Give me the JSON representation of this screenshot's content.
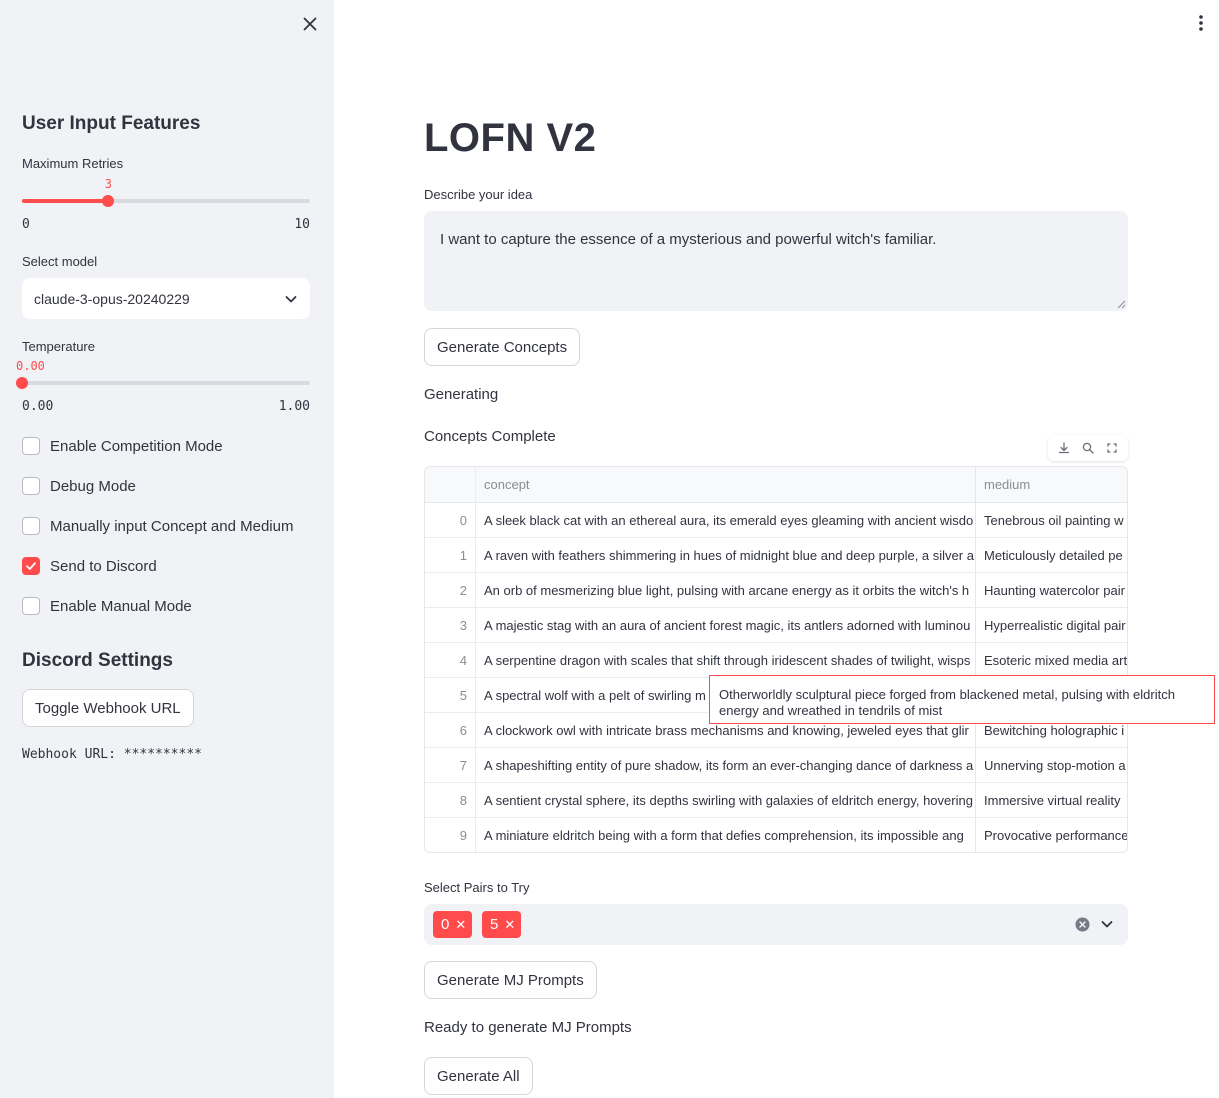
{
  "sidebar": {
    "heading": "User Input Features",
    "max_retries": {
      "label": "Maximum Retries",
      "value": "3",
      "min": "0",
      "max": "10",
      "fraction": 0.3
    },
    "model": {
      "label": "Select model",
      "value": "claude-3-opus-20240229"
    },
    "temperature": {
      "label": "Temperature",
      "value": "0.00",
      "min": "0.00",
      "max": "1.00",
      "fraction": 0.0
    },
    "checkboxes": [
      {
        "label": "Enable Competition Mode",
        "checked": false
      },
      {
        "label": "Debug Mode",
        "checked": false
      },
      {
        "label": "Manually input Concept and Medium",
        "checked": false
      },
      {
        "label": "Send to Discord",
        "checked": true
      },
      {
        "label": "Enable Manual Mode",
        "checked": false
      }
    ],
    "discord_heading": "Discord Settings",
    "toggle_webhook_label": "Toggle Webhook URL",
    "webhook_text": "Webhook URL: **********"
  },
  "main": {
    "title": "LOFN V2",
    "idea_label": "Describe your idea",
    "idea_value": "I want to capture the essence of a mysterious and powerful witch's familiar.",
    "generate_concepts_label": "Generate Concepts",
    "status_generating": "Generating",
    "status_concepts_complete": "Concepts Complete",
    "table": {
      "columns": [
        "concept",
        "medium"
      ],
      "rows": [
        {
          "idx": "0",
          "concept": "A sleek black cat with an ethereal aura, its emerald eyes gleaming with ancient wisdo",
          "medium": "Tenebrous oil painting w"
        },
        {
          "idx": "1",
          "concept": "A raven with feathers shimmering in hues of midnight blue and deep purple, a silver a",
          "medium": "Meticulously detailed pe"
        },
        {
          "idx": "2",
          "concept": "An orb of mesmerizing blue light, pulsing with arcane energy as it orbits the witch's h",
          "medium": "Haunting watercolor pair"
        },
        {
          "idx": "3",
          "concept": "A majestic stag with an aura of ancient forest magic, its antlers adorned with luminou",
          "medium": "Hyperrealistic digital pair"
        },
        {
          "idx": "4",
          "concept": "A serpentine dragon with scales that shift through iridescent shades of twilight, wisps",
          "medium": "Esoteric mixed media art"
        },
        {
          "idx": "5",
          "concept": "A spectral wolf with a pelt of swirling m",
          "medium": ""
        },
        {
          "idx": "6",
          "concept": "A clockwork owl with intricate brass mechanisms and knowing, jeweled eyes that glir",
          "medium": "Bewitching holographic i"
        },
        {
          "idx": "7",
          "concept": "A shapeshifting entity of pure shadow, its form an ever-changing dance of darkness a",
          "medium": "Unnerving stop-motion a"
        },
        {
          "idx": "8",
          "concept": "A sentient crystal sphere, its depths swirling with galaxies of eldritch energy, hovering",
          "medium": "Immersive virtual reality"
        },
        {
          "idx": "9",
          "concept": "A miniature eldritch being with a form that defies comprehension, its impossible ang",
          "medium": "Provocative performance"
        }
      ]
    },
    "tooltip_text": "Otherworldly sculptural piece forged from blackened metal, pulsing with eldritch energy and wreathed in tendrils of mist",
    "pairs_label": "Select Pairs to Try",
    "pairs_selected": [
      "0",
      "5"
    ],
    "generate_mj_label": "Generate MJ Prompts",
    "ready_text": "Ready to generate MJ Prompts",
    "generate_all_label": "Generate All"
  },
  "icons": [
    "close-icon",
    "menu-dots-icon",
    "chevron-down-icon",
    "download-icon",
    "search-icon",
    "fullscreen-icon",
    "clear-icon",
    "checkmark-icon"
  ],
  "colors": {
    "accent": "#ff4b4b",
    "sidebar_bg": "#f0f2f6",
    "text": "#31333f"
  }
}
